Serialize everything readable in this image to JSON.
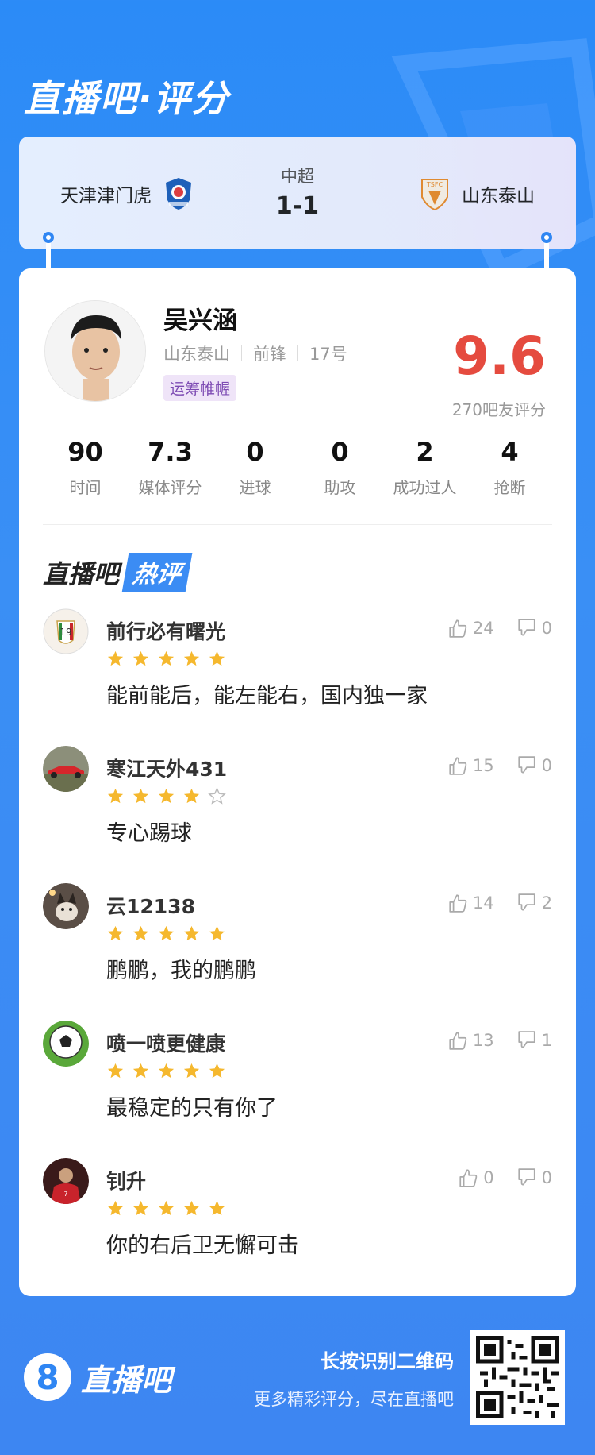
{
  "header": {
    "brand": "直播吧·评分"
  },
  "match": {
    "home_team": "天津津门虎",
    "away_team": "山东泰山",
    "league": "中超",
    "score": "1-1"
  },
  "player": {
    "name": "吴兴涵",
    "club": "山东泰山",
    "position": "前锋",
    "number": "17号",
    "tag": "运筹帷幄",
    "rating": "9.6",
    "rating_count": "270吧友评分",
    "avatar_icon": "player-photo"
  },
  "stats": [
    {
      "value": "90",
      "label": "时间"
    },
    {
      "value": "7.3",
      "label": "媒体评分"
    },
    {
      "value": "0",
      "label": "进球"
    },
    {
      "value": "0",
      "label": "助攻"
    },
    {
      "value": "2",
      "label": "成功过人"
    },
    {
      "value": "4",
      "label": "抢断"
    }
  ],
  "hot_section": {
    "title_a": "直播吧",
    "title_b": "热评"
  },
  "comments": [
    {
      "user": "前行必有曙光",
      "stars": 5,
      "text": "能前能后，能左能右，国内独一家",
      "likes": "24",
      "dislikes": "0"
    },
    {
      "user": "寒江天外431",
      "stars": 4,
      "text": "专心踢球",
      "likes": "15",
      "dislikes": "0"
    },
    {
      "user": "云12138",
      "stars": 5,
      "text": "鹏鹏，我的鹏鹏",
      "likes": "14",
      "dislikes": "2"
    },
    {
      "user": "喷一喷更健康",
      "stars": 5,
      "text": "最稳定的只有你了",
      "likes": "13",
      "dislikes": "1"
    },
    {
      "user": "钊升",
      "stars": 5,
      "text": "你的右后卫无懈可击",
      "likes": "0",
      "dislikes": "0"
    }
  ],
  "footer": {
    "logo_number": "8",
    "logo_text": "直播吧",
    "line1": "长按识别二维码",
    "line2": "更多精彩评分，尽在直播吧"
  },
  "colors": {
    "accent_blue": "#2f86f3",
    "rating_red": "#e54b3f",
    "star_yellow": "#f5b82e",
    "tag_purple": "#7d4bb3"
  }
}
